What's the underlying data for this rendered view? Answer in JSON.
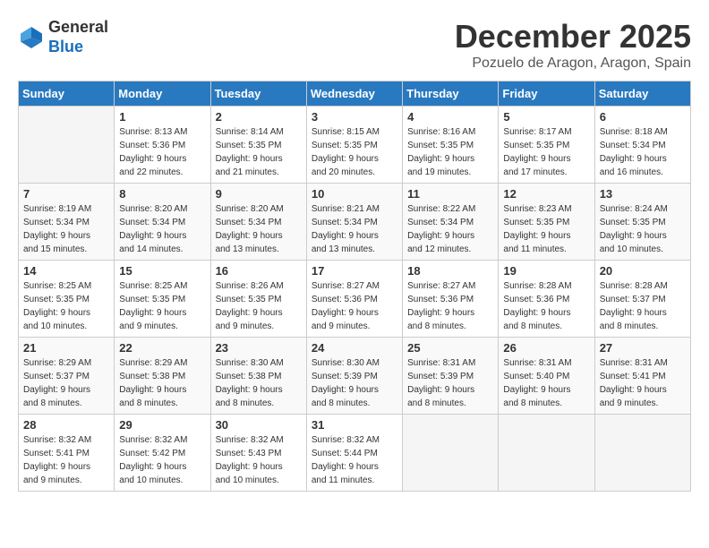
{
  "header": {
    "logo_line1": "General",
    "logo_line2": "Blue",
    "month_title": "December 2025",
    "location": "Pozuelo de Aragon, Aragon, Spain"
  },
  "days_of_week": [
    "Sunday",
    "Monday",
    "Tuesday",
    "Wednesday",
    "Thursday",
    "Friday",
    "Saturday"
  ],
  "weeks": [
    [
      {
        "day": "",
        "info": ""
      },
      {
        "day": "1",
        "info": "Sunrise: 8:13 AM\nSunset: 5:36 PM\nDaylight: 9 hours\nand 22 minutes."
      },
      {
        "day": "2",
        "info": "Sunrise: 8:14 AM\nSunset: 5:35 PM\nDaylight: 9 hours\nand 21 minutes."
      },
      {
        "day": "3",
        "info": "Sunrise: 8:15 AM\nSunset: 5:35 PM\nDaylight: 9 hours\nand 20 minutes."
      },
      {
        "day": "4",
        "info": "Sunrise: 8:16 AM\nSunset: 5:35 PM\nDaylight: 9 hours\nand 19 minutes."
      },
      {
        "day": "5",
        "info": "Sunrise: 8:17 AM\nSunset: 5:35 PM\nDaylight: 9 hours\nand 17 minutes."
      },
      {
        "day": "6",
        "info": "Sunrise: 8:18 AM\nSunset: 5:34 PM\nDaylight: 9 hours\nand 16 minutes."
      }
    ],
    [
      {
        "day": "7",
        "info": "Sunrise: 8:19 AM\nSunset: 5:34 PM\nDaylight: 9 hours\nand 15 minutes."
      },
      {
        "day": "8",
        "info": "Sunrise: 8:20 AM\nSunset: 5:34 PM\nDaylight: 9 hours\nand 14 minutes."
      },
      {
        "day": "9",
        "info": "Sunrise: 8:20 AM\nSunset: 5:34 PM\nDaylight: 9 hours\nand 13 minutes."
      },
      {
        "day": "10",
        "info": "Sunrise: 8:21 AM\nSunset: 5:34 PM\nDaylight: 9 hours\nand 13 minutes."
      },
      {
        "day": "11",
        "info": "Sunrise: 8:22 AM\nSunset: 5:34 PM\nDaylight: 9 hours\nand 12 minutes."
      },
      {
        "day": "12",
        "info": "Sunrise: 8:23 AM\nSunset: 5:35 PM\nDaylight: 9 hours\nand 11 minutes."
      },
      {
        "day": "13",
        "info": "Sunrise: 8:24 AM\nSunset: 5:35 PM\nDaylight: 9 hours\nand 10 minutes."
      }
    ],
    [
      {
        "day": "14",
        "info": "Sunrise: 8:25 AM\nSunset: 5:35 PM\nDaylight: 9 hours\nand 10 minutes."
      },
      {
        "day": "15",
        "info": "Sunrise: 8:25 AM\nSunset: 5:35 PM\nDaylight: 9 hours\nand 9 minutes."
      },
      {
        "day": "16",
        "info": "Sunrise: 8:26 AM\nSunset: 5:35 PM\nDaylight: 9 hours\nand 9 minutes."
      },
      {
        "day": "17",
        "info": "Sunrise: 8:27 AM\nSunset: 5:36 PM\nDaylight: 9 hours\nand 9 minutes."
      },
      {
        "day": "18",
        "info": "Sunrise: 8:27 AM\nSunset: 5:36 PM\nDaylight: 9 hours\nand 8 minutes."
      },
      {
        "day": "19",
        "info": "Sunrise: 8:28 AM\nSunset: 5:36 PM\nDaylight: 9 hours\nand 8 minutes."
      },
      {
        "day": "20",
        "info": "Sunrise: 8:28 AM\nSunset: 5:37 PM\nDaylight: 9 hours\nand 8 minutes."
      }
    ],
    [
      {
        "day": "21",
        "info": "Sunrise: 8:29 AM\nSunset: 5:37 PM\nDaylight: 9 hours\nand 8 minutes."
      },
      {
        "day": "22",
        "info": "Sunrise: 8:29 AM\nSunset: 5:38 PM\nDaylight: 9 hours\nand 8 minutes."
      },
      {
        "day": "23",
        "info": "Sunrise: 8:30 AM\nSunset: 5:38 PM\nDaylight: 9 hours\nand 8 minutes."
      },
      {
        "day": "24",
        "info": "Sunrise: 8:30 AM\nSunset: 5:39 PM\nDaylight: 9 hours\nand 8 minutes."
      },
      {
        "day": "25",
        "info": "Sunrise: 8:31 AM\nSunset: 5:39 PM\nDaylight: 9 hours\nand 8 minutes."
      },
      {
        "day": "26",
        "info": "Sunrise: 8:31 AM\nSunset: 5:40 PM\nDaylight: 9 hours\nand 8 minutes."
      },
      {
        "day": "27",
        "info": "Sunrise: 8:31 AM\nSunset: 5:41 PM\nDaylight: 9 hours\nand 9 minutes."
      }
    ],
    [
      {
        "day": "28",
        "info": "Sunrise: 8:32 AM\nSunset: 5:41 PM\nDaylight: 9 hours\nand 9 minutes."
      },
      {
        "day": "29",
        "info": "Sunrise: 8:32 AM\nSunset: 5:42 PM\nDaylight: 9 hours\nand 10 minutes."
      },
      {
        "day": "30",
        "info": "Sunrise: 8:32 AM\nSunset: 5:43 PM\nDaylight: 9 hours\nand 10 minutes."
      },
      {
        "day": "31",
        "info": "Sunrise: 8:32 AM\nSunset: 5:44 PM\nDaylight: 9 hours\nand 11 minutes."
      },
      {
        "day": "",
        "info": ""
      },
      {
        "day": "",
        "info": ""
      },
      {
        "day": "",
        "info": ""
      }
    ]
  ]
}
